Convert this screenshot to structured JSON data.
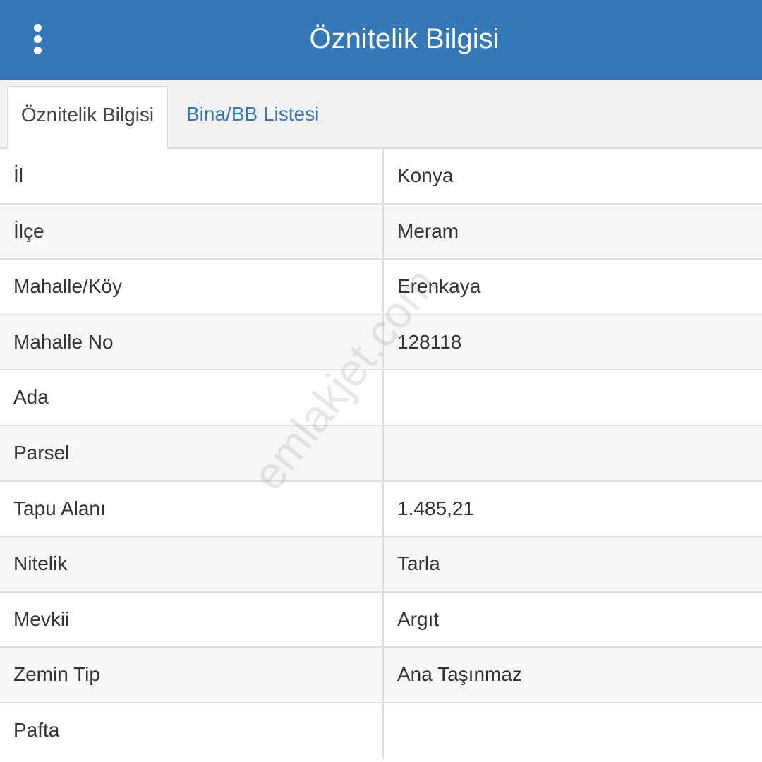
{
  "header": {
    "title": "Öznitelik Bilgisi",
    "menu_icon": "kebab-menu-icon"
  },
  "tabs": [
    {
      "label": "Öznitelik Bilgisi",
      "active": true
    },
    {
      "label": "Bina/BB Listesi",
      "active": false
    }
  ],
  "rows": [
    {
      "label": "İl",
      "value": "Konya"
    },
    {
      "label": "İlçe",
      "value": "Meram"
    },
    {
      "label": "Mahalle/Köy",
      "value": "Erenkaya"
    },
    {
      "label": "Mahalle No",
      "value": "128118"
    },
    {
      "label": "Ada",
      "value": ""
    },
    {
      "label": "Parsel",
      "value": ""
    },
    {
      "label": "Tapu Alanı",
      "value": "1.485,21"
    },
    {
      "label": "Nitelik",
      "value": "Tarla"
    },
    {
      "label": "Mevkii",
      "value": "Argıt"
    },
    {
      "label": "Zemin Tip",
      "value": "Ana Taşınmaz"
    },
    {
      "label": "Pafta",
      "value": ""
    }
  ],
  "watermark": "emlakjet.com",
  "colors": {
    "header_bg": "#3478b7",
    "link": "#3478b7"
  }
}
